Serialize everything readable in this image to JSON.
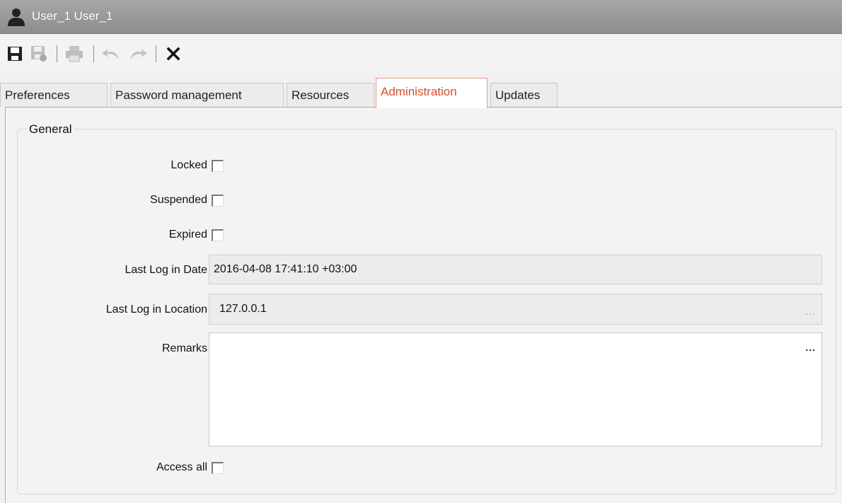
{
  "window": {
    "title": "User_1 User_1",
    "icon": "user-silhouette-icon"
  },
  "toolbar": {
    "items": [
      "save-icon",
      "save-as-icon",
      "print-icon",
      "undo-icon",
      "redo-icon",
      "close-icon"
    ]
  },
  "tabs": [
    {
      "label": "Preferences",
      "active": false
    },
    {
      "label": "Password management",
      "active": false
    },
    {
      "label": "Resources",
      "active": false
    },
    {
      "label": "Administration",
      "active": true
    },
    {
      "label": "Updates",
      "active": false
    }
  ],
  "general": {
    "legend": "General",
    "locked_label": "Locked",
    "locked_checked": false,
    "suspended_label": "Suspended",
    "suspended_checked": false,
    "expired_label": "Expired",
    "expired_checked": false,
    "last_login_date_label": "Last Log in Date",
    "last_login_date_value": "2016-04-08 17:41:10 +03:00",
    "last_login_location_label": "Last Log in Location",
    "last_login_location_value": "127.0.0.1",
    "last_login_location_more": "...",
    "remarks_label": "Remarks",
    "remarks_value": "",
    "remarks_more": "...",
    "access_all_label": "Access all",
    "access_all_checked": false
  },
  "colors": {
    "accent": "#d2502a",
    "tab_border": "#e29b84",
    "titlebar": "#999999"
  }
}
